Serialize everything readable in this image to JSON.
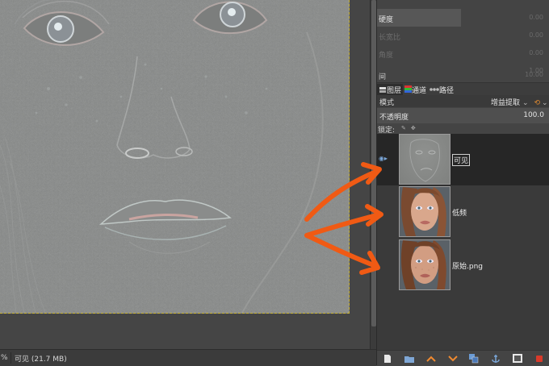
{
  "canvas": {
    "zoom_fragment": "%",
    "status": "可见 (21.7 MB)"
  },
  "brush_options": {
    "hardness_label": "硬度",
    "dim_rows": [
      {
        "label": "",
        "value": "0.00"
      },
      {
        "label": "长宽比",
        "value": "0.00"
      },
      {
        "label": "角度",
        "value": "0.00"
      },
      {
        "label": "",
        "value": "1.00"
      },
      {
        "label": "间",
        "value": "10.00"
      }
    ]
  },
  "tabs": [
    {
      "icon": "layers-icon",
      "label": "图层"
    },
    {
      "icon": "channels-icon",
      "label": "通道"
    },
    {
      "icon": "paths-icon",
      "label": "路径"
    }
  ],
  "layer_panel": {
    "mode_label": "模式",
    "mode_value": "增益提取",
    "opacity_label": "不透明度",
    "opacity_value": "100.0",
    "lock_label": "锁定:"
  },
  "layers": [
    {
      "name": "可见",
      "visible": true,
      "selected": true,
      "kind": "highpass"
    },
    {
      "name": "低频",
      "visible": false,
      "selected": false,
      "kind": "photo"
    },
    {
      "name": "原始.png",
      "visible": false,
      "selected": false,
      "kind": "photo"
    }
  ],
  "toolbar": [
    {
      "name": "new-layer-icon",
      "glyph": "🗋"
    },
    {
      "name": "new-layer-group-icon",
      "glyph": "🗀"
    },
    {
      "name": "raise-layer-icon",
      "glyph": "⌃"
    },
    {
      "name": "lower-layer-icon",
      "glyph": "⌄"
    },
    {
      "name": "duplicate-layer-icon",
      "glyph": "⧉"
    },
    {
      "name": "anchor-layer-icon",
      "glyph": "⚓"
    },
    {
      "name": "layer-mask-icon",
      "glyph": "◩"
    },
    {
      "name": "delete-layer-icon",
      "glyph": "✖"
    }
  ],
  "colors": {
    "arrow": "#f05a14",
    "selection_border": "#c8b33a",
    "accent_delete": "#d83a2a"
  }
}
